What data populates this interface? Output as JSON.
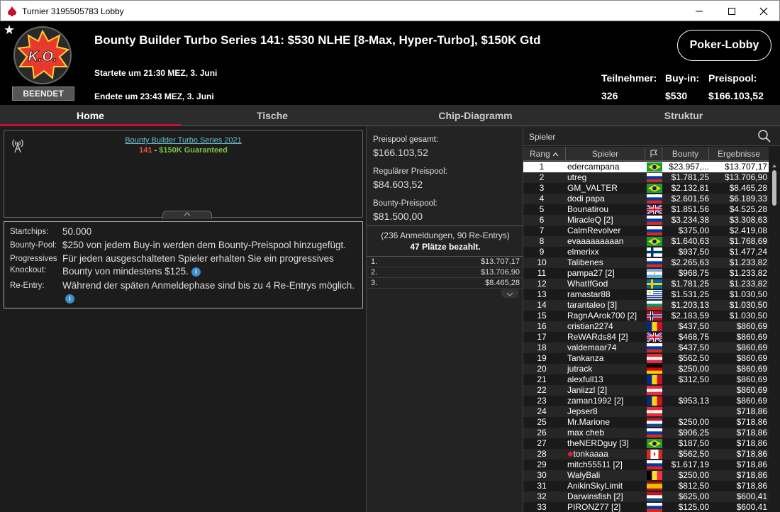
{
  "window": {
    "title": "Turnier 3195505783 Lobby"
  },
  "header": {
    "title": "Bounty Builder Turbo Series 141: $530 NLHE [8-Max, Hyper-Turbo], $150K Gtd",
    "logo_text": "K.O.",
    "status_badge": "BEENDET",
    "started": "Startete um 21:30 MEZ, 3. Juni",
    "ended": "Endete um 23:43 MEZ, 3. Juni",
    "lobby_button": "Poker-Lobby",
    "participants_label": "Teilnehmer:",
    "participants_value": "326",
    "buyin_label": "Buy-in:",
    "buyin_value": "$530",
    "prizepool_label": "Preispool:",
    "prizepool_value": "$166.103,52"
  },
  "tabs": [
    "Home",
    "Tische",
    "Chip-Diagramm",
    "Struktur"
  ],
  "info_panel": {
    "series_link": "Bounty Builder Turbo Series 2021",
    "event_number": "141",
    "event_separator": " - ",
    "event_guarantee": "$150K Guaranteed"
  },
  "details": {
    "startchips_label": "Startchips:",
    "startchips_value": "50.000",
    "bountypool_label": "Bounty-Pool:",
    "bountypool_value": "$250 von jedem Buy-in werden dem Bounty-Preispool hinzugefügt.",
    "pko_label_1": "Progressives",
    "pko_label_2": "Knockout:",
    "pko_value": "Für jeden ausgeschalteten Spieler erhalten Sie ein progressives Bounty von mindestens $125.",
    "reentry_label": "Re-Entry:",
    "reentry_value": "Während der späten Anmeldephase sind bis zu 4 Re-Entrys möglich."
  },
  "prizes": {
    "total_label": "Preispool gesamt:",
    "total_value": "$166.103,52",
    "regular_label": "Regulärer Preispool:",
    "regular_value": "$84.603,52",
    "bounty_label": "Bounty-Preispool:",
    "bounty_value": "$81.500,00",
    "registrations": "(236 Anmeldungen, 90 Re-Entrys)",
    "places_paid": "47 Plätze bezahlt.",
    "payouts": [
      {
        "rank": "1.",
        "amount": "$13.707,17"
      },
      {
        "rank": "2.",
        "amount": "$13.706,90"
      },
      {
        "rank": "3.",
        "amount": "$8.465,28"
      }
    ]
  },
  "players": {
    "search_placeholder": "Spieler",
    "columns": {
      "rank": "Rang",
      "player": "Spieler",
      "bounty": "Bounty",
      "result": "Ergebnisse"
    },
    "rows": [
      {
        "rank": "1",
        "name": "edercampana",
        "flag": "br",
        "bounty": "$23.957,...",
        "result": "$13.707,17"
      },
      {
        "rank": "2",
        "name": "utreg",
        "flag": "ru",
        "bounty": "$1.781,25",
        "result": "$13.706,90"
      },
      {
        "rank": "3",
        "name": "GM_VALTER",
        "flag": "br",
        "bounty": "$2.132,81",
        "result": "$8.465,28"
      },
      {
        "rank": "4",
        "name": "dodi papa",
        "flag": "ru",
        "bounty": "$2.601,56",
        "result": "$6.189,33"
      },
      {
        "rank": "5",
        "name": "Bounatirou",
        "flag": "gb",
        "bounty": "$1.851,56",
        "result": "$4.525,28"
      },
      {
        "rank": "6",
        "name": "MiracleQ [2]",
        "flag": "ru",
        "bounty": "$3.234,38",
        "result": "$3.308,63"
      },
      {
        "rank": "7",
        "name": "CalmRevolver",
        "flag": "ru",
        "bounty": "$375,00",
        "result": "$2.419,08"
      },
      {
        "rank": "8",
        "name": "evaaaaaaaaan",
        "flag": "br",
        "bounty": "$1.640,63",
        "result": "$1.768,69"
      },
      {
        "rank": "9",
        "name": "elmerixx",
        "flag": "fi",
        "bounty": "$937,50",
        "result": "$1.477,24"
      },
      {
        "rank": "10",
        "name": "Talibenes",
        "flag": "ru",
        "bounty": "$2.265,63",
        "result": "$1.233,82"
      },
      {
        "rank": "11",
        "name": "pampa27 [2]",
        "flag": "ar",
        "bounty": "$968,75",
        "result": "$1.233,82"
      },
      {
        "rank": "12",
        "name": "WhatIfGod",
        "flag": "se",
        "bounty": "$1.781,25",
        "result": "$1.233,82"
      },
      {
        "rank": "13",
        "name": "ramastar88",
        "flag": "uy",
        "bounty": "$1.531,25",
        "result": "$1.030,50"
      },
      {
        "rank": "14",
        "name": "tarantaleo [3]",
        "flag": "bg",
        "bounty": "$1.203,13",
        "result": "$1.030,50"
      },
      {
        "rank": "15",
        "name": "RagnAArok700 [2]",
        "flag": "no",
        "bounty": "$2.183,59",
        "result": "$1.030,50"
      },
      {
        "rank": "16",
        "name": "cristian2274",
        "flag": "ro",
        "bounty": "$437,50",
        "result": "$860,69"
      },
      {
        "rank": "17",
        "name": "ReWARds84 [2]",
        "flag": "gb",
        "bounty": "$468,75",
        "result": "$860,69"
      },
      {
        "rank": "18",
        "name": "valdemaar74",
        "flag": "ru",
        "bounty": "$437,50",
        "result": "$860,69"
      },
      {
        "rank": "19",
        "name": "Tankanza",
        "flag": "at",
        "bounty": "$562,50",
        "result": "$860,69"
      },
      {
        "rank": "20",
        "name": "jutrack",
        "flag": "de",
        "bounty": "$250,00",
        "result": "$860,69"
      },
      {
        "rank": "21",
        "name": "alexfull13",
        "flag": "ro",
        "bounty": "$312,50",
        "result": "$860,69"
      },
      {
        "rank": "22",
        "name": "Janiizzl [2]",
        "flag": "at",
        "bounty": "",
        "result": "$860,69"
      },
      {
        "rank": "23",
        "name": "zaman1992 [2]",
        "flag": "ro",
        "bounty": "$953,13",
        "result": "$860,69"
      },
      {
        "rank": "24",
        "name": "Jepser8",
        "flag": "at",
        "bounty": "",
        "result": "$718,86"
      },
      {
        "rank": "25",
        "name": "Mr.Marione",
        "flag": "nl",
        "bounty": "$250,00",
        "result": "$718,86"
      },
      {
        "rank": "26",
        "name": "max cheb",
        "flag": "ru",
        "bounty": "$906,25",
        "result": "$718,86"
      },
      {
        "rank": "27",
        "name": "theNERDguy [3]",
        "flag": "br",
        "bounty": "$187,50",
        "result": "$718,86"
      },
      {
        "rank": "28",
        "name": "tonkaaaa",
        "flag": "ca",
        "bounty": "$562,50",
        "result": "$718,86",
        "ps_star": "✱"
      },
      {
        "rank": "29",
        "name": "mitch55511 [2]",
        "flag": "ru",
        "bounty": "$1.617,19",
        "result": "$718,86"
      },
      {
        "rank": "30",
        "name": "WalyBali",
        "flag": "be",
        "bounty": "$250,00",
        "result": "$718,86"
      },
      {
        "rank": "31",
        "name": "AnikinSkyLimit",
        "flag": "es",
        "bounty": "$812,50",
        "result": "$718,86"
      },
      {
        "rank": "32",
        "name": "Darwinsfish [2]",
        "flag": "nl",
        "bounty": "$625,00",
        "result": "$600,41"
      },
      {
        "rank": "33",
        "name": "PIRONZ77 [2]",
        "flag": "ru",
        "bounty": "$125,00",
        "result": "$600,41"
      }
    ]
  },
  "colors": {
    "accent": "#c8102e",
    "event_number": "#e8543a",
    "guarantee": "#7cc242",
    "link": "#6bbfd0"
  }
}
